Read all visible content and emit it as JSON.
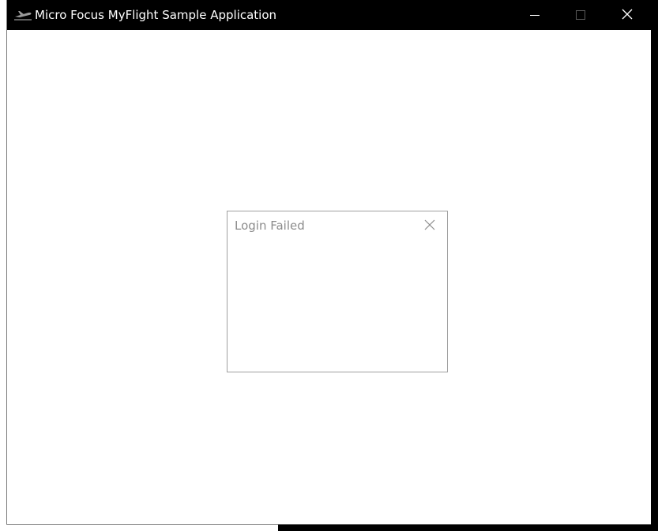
{
  "window": {
    "title": "Micro Focus MyFlight Sample Application",
    "icon": "airplane-icon",
    "caption_buttons": {
      "minimize_icon": "minimize-icon",
      "maximize_icon": "maximize-icon",
      "close_icon": "close-icon"
    }
  },
  "dialog": {
    "title": "Login Failed",
    "close_icon": "close-icon",
    "message": ""
  },
  "colors": {
    "titlebar_bg": "#000000",
    "titlebar_text": "#ffffff",
    "dialog_border": "#a0a0a0",
    "dialog_title_text": "#8c8c8c",
    "disabled_icon": "#5a5a5a"
  }
}
